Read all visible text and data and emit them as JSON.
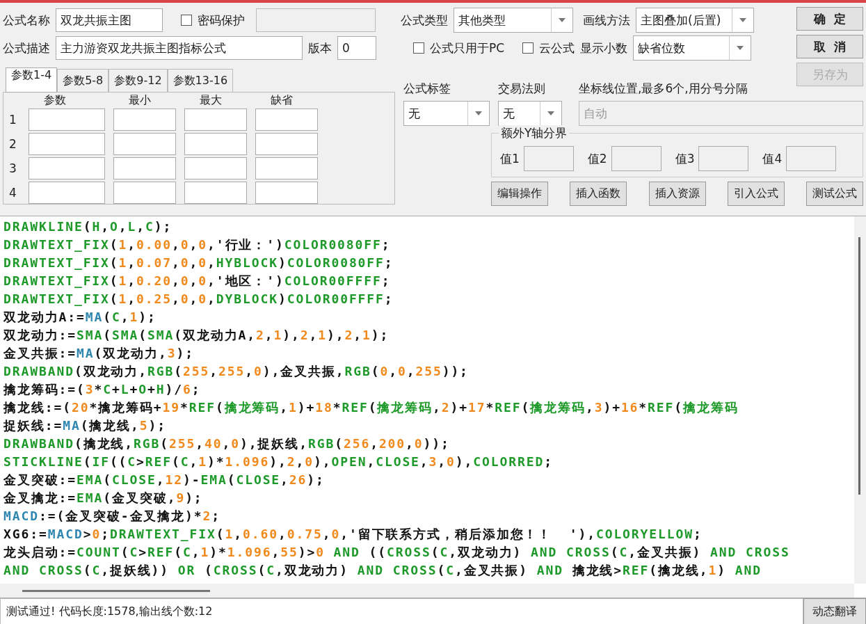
{
  "formula_name": {
    "label": "公式名称",
    "value": "双龙共振主图"
  },
  "password_protect": {
    "label": "密码保护",
    "checked": false
  },
  "password_field": {
    "disabled": true
  },
  "description": {
    "label": "公式描述",
    "value": "主力游资双龙共振主图指标公式"
  },
  "version": {
    "label": "版本",
    "value": "0"
  },
  "param_tabs": [
    {
      "label": "参数1-4",
      "selected": true
    },
    {
      "label": "参数5-8",
      "selected": false
    },
    {
      "label": "参数9-12",
      "selected": false
    },
    {
      "label": "参数13-16",
      "selected": false
    }
  ],
  "param_table": {
    "columns": [
      "参数",
      "最小",
      "最大",
      "缺省"
    ],
    "rows": [
      "1",
      "2",
      "3",
      "4"
    ]
  },
  "formula_type": {
    "label": "公式类型",
    "value": "其他类型"
  },
  "draw_method": {
    "label": "画线方法",
    "value": "主图叠加(后置)"
  },
  "options": [
    {
      "label": "公式只用于PC",
      "checked": false
    },
    {
      "label": "云公式",
      "checked": false
    }
  ],
  "decimals": {
    "label": "显示小数",
    "value": "缺省位数"
  },
  "dialog_buttons": [
    {
      "label": "确  定",
      "disabled": false
    },
    {
      "label": "取  消",
      "disabled": false
    },
    {
      "label": "另存为",
      "disabled": true
    }
  ],
  "formula_tag": {
    "label": "公式标签",
    "value": "无"
  },
  "trade_rule": {
    "label": "交易法则",
    "value": "无"
  },
  "axis_lines": {
    "label": "坐标线位置,最多6个,用分号分隔",
    "value": "自动",
    "disabled": true
  },
  "y_bounds": {
    "title": "额外Y轴分界",
    "fields": [
      "值1",
      "值2",
      "值3",
      "值4"
    ]
  },
  "tool_buttons": [
    "编辑操作",
    "插入函数",
    "插入资源",
    "引入公式",
    "测试公式"
  ],
  "code_lines": [
    [
      {
        "kind": "fn",
        "text": "DRAWKLINE"
      },
      {
        "kind": "plain",
        "text": "("
      },
      {
        "kind": "fn",
        "text": "H"
      },
      {
        "kind": "plain",
        "text": ","
      },
      {
        "kind": "fn",
        "text": "O"
      },
      {
        "kind": "plain",
        "text": ","
      },
      {
        "kind": "fn",
        "text": "L"
      },
      {
        "kind": "plain",
        "text": ","
      },
      {
        "kind": "fn",
        "text": "C"
      },
      {
        "kind": "plain",
        "text": ");"
      }
    ],
    [
      {
        "kind": "fn",
        "text": "DRAWTEXT_FIX"
      },
      {
        "kind": "plain",
        "text": "("
      },
      {
        "kind": "num",
        "text": "1"
      },
      {
        "kind": "plain",
        "text": ","
      },
      {
        "kind": "num",
        "text": "0.00"
      },
      {
        "kind": "plain",
        "text": ","
      },
      {
        "kind": "num",
        "text": "0"
      },
      {
        "kind": "plain",
        "text": ","
      },
      {
        "kind": "num",
        "text": "0"
      },
      {
        "kind": "plain",
        "text": ",'行业：')"
      },
      {
        "kind": "fn",
        "text": "COLOR0080FF"
      },
      {
        "kind": "plain",
        "text": ";"
      }
    ],
    [
      {
        "kind": "fn",
        "text": "DRAWTEXT_FIX"
      },
      {
        "kind": "plain",
        "text": "("
      },
      {
        "kind": "num",
        "text": "1"
      },
      {
        "kind": "plain",
        "text": ","
      },
      {
        "kind": "num",
        "text": "0.07"
      },
      {
        "kind": "plain",
        "text": ","
      },
      {
        "kind": "num",
        "text": "0"
      },
      {
        "kind": "plain",
        "text": ","
      },
      {
        "kind": "num",
        "text": "0"
      },
      {
        "kind": "plain",
        "text": ","
      },
      {
        "kind": "fn",
        "text": "HYBLOCK"
      },
      {
        "kind": "plain",
        "text": ")"
      },
      {
        "kind": "fn",
        "text": "COLOR0080FF"
      },
      {
        "kind": "plain",
        "text": ";"
      }
    ],
    [
      {
        "kind": "fn",
        "text": "DRAWTEXT_FIX"
      },
      {
        "kind": "plain",
        "text": "("
      },
      {
        "kind": "num",
        "text": "1"
      },
      {
        "kind": "plain",
        "text": ","
      },
      {
        "kind": "num",
        "text": "0.20"
      },
      {
        "kind": "plain",
        "text": ","
      },
      {
        "kind": "num",
        "text": "0"
      },
      {
        "kind": "plain",
        "text": ","
      },
      {
        "kind": "num",
        "text": "0"
      },
      {
        "kind": "plain",
        "text": ",'地区：')"
      },
      {
        "kind": "fn",
        "text": "COLOR00FFFF"
      },
      {
        "kind": "plain",
        "text": ";"
      }
    ],
    [
      {
        "kind": "fn",
        "text": "DRAWTEXT_FIX"
      },
      {
        "kind": "plain",
        "text": "("
      },
      {
        "kind": "num",
        "text": "1"
      },
      {
        "kind": "plain",
        "text": ","
      },
      {
        "kind": "num",
        "text": "0.25"
      },
      {
        "kind": "plain",
        "text": ","
      },
      {
        "kind": "num",
        "text": "0"
      },
      {
        "kind": "plain",
        "text": ","
      },
      {
        "kind": "num",
        "text": "0"
      },
      {
        "kind": "plain",
        "text": ","
      },
      {
        "kind": "fn",
        "text": "DYBLOCK"
      },
      {
        "kind": "plain",
        "text": ")"
      },
      {
        "kind": "fn",
        "text": "COLOR00FFFF"
      },
      {
        "kind": "plain",
        "text": ";"
      }
    ],
    [
      {
        "kind": "plain",
        "text": "双龙动力A:="
      },
      {
        "kind": "builtin",
        "text": "MA"
      },
      {
        "kind": "plain",
        "text": "("
      },
      {
        "kind": "fn",
        "text": "C"
      },
      {
        "kind": "plain",
        "text": ","
      },
      {
        "kind": "num",
        "text": "1"
      },
      {
        "kind": "plain",
        "text": ");"
      }
    ],
    [
      {
        "kind": "plain",
        "text": "双龙动力:="
      },
      {
        "kind": "fn",
        "text": "SMA"
      },
      {
        "kind": "plain",
        "text": "("
      },
      {
        "kind": "fn",
        "text": "SMA"
      },
      {
        "kind": "plain",
        "text": "("
      },
      {
        "kind": "fn",
        "text": "SMA"
      },
      {
        "kind": "plain",
        "text": "(双龙动力A,"
      },
      {
        "kind": "num",
        "text": "2"
      },
      {
        "kind": "plain",
        "text": ","
      },
      {
        "kind": "num",
        "text": "1"
      },
      {
        "kind": "plain",
        "text": "),"
      },
      {
        "kind": "num",
        "text": "2"
      },
      {
        "kind": "plain",
        "text": ","
      },
      {
        "kind": "num",
        "text": "1"
      },
      {
        "kind": "plain",
        "text": "),"
      },
      {
        "kind": "num",
        "text": "2"
      },
      {
        "kind": "plain",
        "text": ","
      },
      {
        "kind": "num",
        "text": "1"
      },
      {
        "kind": "plain",
        "text": ");"
      }
    ],
    [
      {
        "kind": "plain",
        "text": "金叉共振:="
      },
      {
        "kind": "builtin",
        "text": "MA"
      },
      {
        "kind": "plain",
        "text": "(双龙动力,"
      },
      {
        "kind": "num",
        "text": "3"
      },
      {
        "kind": "plain",
        "text": ");"
      }
    ],
    [
      {
        "kind": "fn",
        "text": "DRAWBAND"
      },
      {
        "kind": "plain",
        "text": "(双龙动力,"
      },
      {
        "kind": "fn",
        "text": "RGB"
      },
      {
        "kind": "plain",
        "text": "("
      },
      {
        "kind": "num",
        "text": "255"
      },
      {
        "kind": "plain",
        "text": ","
      },
      {
        "kind": "num",
        "text": "255"
      },
      {
        "kind": "plain",
        "text": ","
      },
      {
        "kind": "num",
        "text": "0"
      },
      {
        "kind": "plain",
        "text": "),金叉共振,"
      },
      {
        "kind": "fn",
        "text": "RGB"
      },
      {
        "kind": "plain",
        "text": "("
      },
      {
        "kind": "num",
        "text": "0"
      },
      {
        "kind": "plain",
        "text": ","
      },
      {
        "kind": "num",
        "text": "0"
      },
      {
        "kind": "plain",
        "text": ","
      },
      {
        "kind": "num",
        "text": "255"
      },
      {
        "kind": "plain",
        "text": "));"
      }
    ],
    [
      {
        "kind": "plain",
        "text": "擒龙筹码:=("
      },
      {
        "kind": "num",
        "text": "3"
      },
      {
        "kind": "plain",
        "text": "*"
      },
      {
        "kind": "fn",
        "text": "C"
      },
      {
        "kind": "plain",
        "text": "+"
      },
      {
        "kind": "fn",
        "text": "L"
      },
      {
        "kind": "plain",
        "text": "+"
      },
      {
        "kind": "fn",
        "text": "O"
      },
      {
        "kind": "plain",
        "text": "+"
      },
      {
        "kind": "fn",
        "text": "H"
      },
      {
        "kind": "plain",
        "text": ")/"
      },
      {
        "kind": "num",
        "text": "6"
      },
      {
        "kind": "plain",
        "text": ";"
      }
    ],
    [
      {
        "kind": "plain",
        "text": "擒龙线:=("
      },
      {
        "kind": "num",
        "text": "20"
      },
      {
        "kind": "plain",
        "text": "*擒龙筹码+"
      },
      {
        "kind": "num",
        "text": "19"
      },
      {
        "kind": "plain",
        "text": "*"
      },
      {
        "kind": "fn",
        "text": "REF"
      },
      {
        "kind": "plain",
        "text": "("
      },
      {
        "kind": "fn",
        "text": "擒龙筹码"
      },
      {
        "kind": "plain",
        "text": ","
      },
      {
        "kind": "num",
        "text": "1"
      },
      {
        "kind": "plain",
        "text": ")+"
      },
      {
        "kind": "num",
        "text": "18"
      },
      {
        "kind": "plain",
        "text": "*"
      },
      {
        "kind": "fn",
        "text": "REF"
      },
      {
        "kind": "plain",
        "text": "("
      },
      {
        "kind": "fn",
        "text": "擒龙筹码"
      },
      {
        "kind": "plain",
        "text": ","
      },
      {
        "kind": "num",
        "text": "2"
      },
      {
        "kind": "plain",
        "text": ")+"
      },
      {
        "kind": "num",
        "text": "17"
      },
      {
        "kind": "plain",
        "text": "*"
      },
      {
        "kind": "fn",
        "text": "REF"
      },
      {
        "kind": "plain",
        "text": "("
      },
      {
        "kind": "fn",
        "text": "擒龙筹码"
      },
      {
        "kind": "plain",
        "text": ","
      },
      {
        "kind": "num",
        "text": "3"
      },
      {
        "kind": "plain",
        "text": ")+"
      },
      {
        "kind": "num",
        "text": "16"
      },
      {
        "kind": "plain",
        "text": "*"
      },
      {
        "kind": "fn",
        "text": "REF"
      },
      {
        "kind": "plain",
        "text": "("
      },
      {
        "kind": "fn",
        "text": "擒龙筹码"
      }
    ],
    [
      {
        "kind": "plain",
        "text": "捉妖线:="
      },
      {
        "kind": "builtin",
        "text": "MA"
      },
      {
        "kind": "plain",
        "text": "(擒龙线,"
      },
      {
        "kind": "num",
        "text": "5"
      },
      {
        "kind": "plain",
        "text": ");"
      }
    ],
    [
      {
        "kind": "fn",
        "text": "DRAWBAND"
      },
      {
        "kind": "plain",
        "text": "(擒龙线,"
      },
      {
        "kind": "fn",
        "text": "RGB"
      },
      {
        "kind": "plain",
        "text": "("
      },
      {
        "kind": "num",
        "text": "255"
      },
      {
        "kind": "plain",
        "text": ","
      },
      {
        "kind": "num",
        "text": "40"
      },
      {
        "kind": "plain",
        "text": ","
      },
      {
        "kind": "num",
        "text": "0"
      },
      {
        "kind": "plain",
        "text": "),捉妖线,"
      },
      {
        "kind": "fn",
        "text": "RGB"
      },
      {
        "kind": "plain",
        "text": "("
      },
      {
        "kind": "num",
        "text": "256"
      },
      {
        "kind": "plain",
        "text": ","
      },
      {
        "kind": "num",
        "text": "200"
      },
      {
        "kind": "plain",
        "text": ","
      },
      {
        "kind": "num",
        "text": "0"
      },
      {
        "kind": "plain",
        "text": "));"
      }
    ],
    [
      {
        "kind": "fn",
        "text": "STICKLINE"
      },
      {
        "kind": "plain",
        "text": "("
      },
      {
        "kind": "fn",
        "text": "IF"
      },
      {
        "kind": "plain",
        "text": "(("
      },
      {
        "kind": "fn",
        "text": "C"
      },
      {
        "kind": "plain",
        "text": ">"
      },
      {
        "kind": "fn",
        "text": "REF"
      },
      {
        "kind": "plain",
        "text": "("
      },
      {
        "kind": "fn",
        "text": "C"
      },
      {
        "kind": "plain",
        "text": ","
      },
      {
        "kind": "num",
        "text": "1"
      },
      {
        "kind": "plain",
        "text": ")*"
      },
      {
        "kind": "num",
        "text": "1.096"
      },
      {
        "kind": "plain",
        "text": "),"
      },
      {
        "kind": "num",
        "text": "2"
      },
      {
        "kind": "plain",
        "text": ","
      },
      {
        "kind": "num",
        "text": "0"
      },
      {
        "kind": "plain",
        "text": "),"
      },
      {
        "kind": "fn",
        "text": "OPEN"
      },
      {
        "kind": "plain",
        "text": ","
      },
      {
        "kind": "fn",
        "text": "CLOSE"
      },
      {
        "kind": "plain",
        "text": ","
      },
      {
        "kind": "num",
        "text": "3"
      },
      {
        "kind": "plain",
        "text": ","
      },
      {
        "kind": "num",
        "text": "0"
      },
      {
        "kind": "plain",
        "text": "),"
      },
      {
        "kind": "fn",
        "text": "COLORRED"
      },
      {
        "kind": "plain",
        "text": ";"
      }
    ],
    [
      {
        "kind": "plain",
        "text": "金叉突破:="
      },
      {
        "kind": "fn",
        "text": "EMA"
      },
      {
        "kind": "plain",
        "text": "("
      },
      {
        "kind": "fn",
        "text": "CLOSE"
      },
      {
        "kind": "plain",
        "text": ","
      },
      {
        "kind": "num",
        "text": "12"
      },
      {
        "kind": "plain",
        "text": ")-"
      },
      {
        "kind": "fn",
        "text": "EMA"
      },
      {
        "kind": "plain",
        "text": "("
      },
      {
        "kind": "fn",
        "text": "CLOSE"
      },
      {
        "kind": "plain",
        "text": ","
      },
      {
        "kind": "num",
        "text": "26"
      },
      {
        "kind": "plain",
        "text": ");"
      }
    ],
    [
      {
        "kind": "plain",
        "text": "金叉擒龙:="
      },
      {
        "kind": "fn",
        "text": "EMA"
      },
      {
        "kind": "plain",
        "text": "(金叉突破,"
      },
      {
        "kind": "num",
        "text": "9"
      },
      {
        "kind": "plain",
        "text": ");"
      }
    ],
    [
      {
        "kind": "builtin",
        "text": "MACD"
      },
      {
        "kind": "plain",
        "text": ":=(金叉突破-金叉擒龙)*"
      },
      {
        "kind": "num",
        "text": "2"
      },
      {
        "kind": "plain",
        "text": ";"
      }
    ],
    [
      {
        "kind": "plain",
        "text": "XG6:="
      },
      {
        "kind": "builtin",
        "text": "MACD"
      },
      {
        "kind": "plain",
        "text": ">"
      },
      {
        "kind": "num",
        "text": "0"
      },
      {
        "kind": "plain",
        "text": ";"
      },
      {
        "kind": "fn",
        "text": "DRAWTEXT_FIX"
      },
      {
        "kind": "plain",
        "text": "("
      },
      {
        "kind": "num",
        "text": "1"
      },
      {
        "kind": "plain",
        "text": ","
      },
      {
        "kind": "num",
        "text": "0.60"
      },
      {
        "kind": "plain",
        "text": ","
      },
      {
        "kind": "num",
        "text": "0.75"
      },
      {
        "kind": "plain",
        "text": ","
      },
      {
        "kind": "num",
        "text": "0"
      },
      {
        "kind": "plain",
        "text": ",'留下联系方式，稍后添加您！！  '),"
      },
      {
        "kind": "fn",
        "text": "COLORYELLOW"
      },
      {
        "kind": "plain",
        "text": ";"
      }
    ],
    [
      {
        "kind": "plain",
        "text": "龙头启动:="
      },
      {
        "kind": "fn",
        "text": "COUNT"
      },
      {
        "kind": "plain",
        "text": "("
      },
      {
        "kind": "fn",
        "text": "C"
      },
      {
        "kind": "plain",
        "text": ">"
      },
      {
        "kind": "fn",
        "text": "REF"
      },
      {
        "kind": "plain",
        "text": "("
      },
      {
        "kind": "fn",
        "text": "C"
      },
      {
        "kind": "plain",
        "text": ","
      },
      {
        "kind": "num",
        "text": "1"
      },
      {
        "kind": "plain",
        "text": ")*"
      },
      {
        "kind": "num",
        "text": "1.096"
      },
      {
        "kind": "plain",
        "text": ","
      },
      {
        "kind": "num",
        "text": "55"
      },
      {
        "kind": "plain",
        "text": ")>"
      },
      {
        "kind": "num",
        "text": "0"
      },
      {
        "kind": "fn",
        "text": " AND "
      },
      {
        "kind": "plain",
        "text": "(("
      },
      {
        "kind": "fn",
        "text": "CROSS"
      },
      {
        "kind": "plain",
        "text": "("
      },
      {
        "kind": "fn",
        "text": "C"
      },
      {
        "kind": "plain",
        "text": ",双龙动力)"
      },
      {
        "kind": "fn",
        "text": " AND CROSS"
      },
      {
        "kind": "plain",
        "text": "("
      },
      {
        "kind": "fn",
        "text": "C"
      },
      {
        "kind": "plain",
        "text": ",金叉共振)"
      },
      {
        "kind": "fn",
        "text": " AND CROSS"
      }
    ],
    [
      {
        "kind": "fn",
        "text": "AND CROSS"
      },
      {
        "kind": "plain",
        "text": "("
      },
      {
        "kind": "fn",
        "text": "C"
      },
      {
        "kind": "plain",
        "text": ",捉妖线))"
      },
      {
        "kind": "fn",
        "text": " OR "
      },
      {
        "kind": "plain",
        "text": "("
      },
      {
        "kind": "fn",
        "text": "CROSS"
      },
      {
        "kind": "plain",
        "text": "("
      },
      {
        "kind": "fn",
        "text": "C"
      },
      {
        "kind": "plain",
        "text": ",双龙动力)"
      },
      {
        "kind": "fn",
        "text": " AND CROSS"
      },
      {
        "kind": "plain",
        "text": "("
      },
      {
        "kind": "fn",
        "text": "C"
      },
      {
        "kind": "plain",
        "text": ",金叉共振)"
      },
      {
        "kind": "fn",
        "text": " AND "
      },
      {
        "kind": "plain",
        "text": "擒龙线>"
      },
      {
        "kind": "fn",
        "text": "REF"
      },
      {
        "kind": "plain",
        "text": "(擒龙线,"
      },
      {
        "kind": "num",
        "text": "1"
      },
      {
        "kind": "plain",
        "text": ")"
      },
      {
        "kind": "fn",
        "text": " AND"
      }
    ]
  ],
  "status": "测试通过! 代码长度:1578,输出线个数:12",
  "translate_button": "动态翻译"
}
